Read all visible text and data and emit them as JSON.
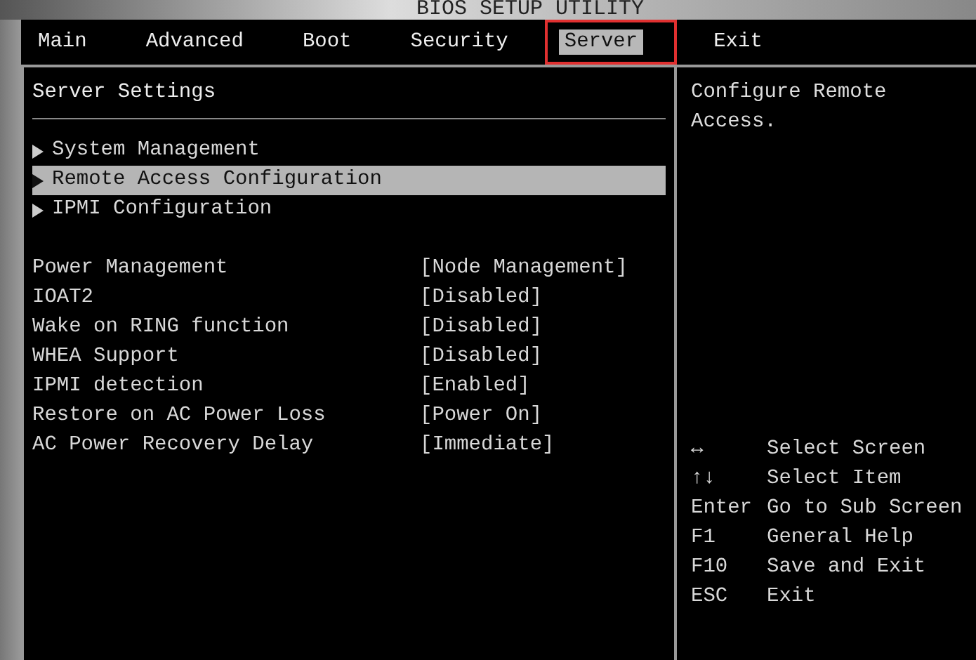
{
  "window": {
    "title": "BIOS SETUP UTILITY"
  },
  "tabs": [
    {
      "label": "Main",
      "selected": false,
      "annotated": false
    },
    {
      "label": "Advanced",
      "selected": false,
      "annotated": false
    },
    {
      "label": "Boot",
      "selected": false,
      "annotated": false
    },
    {
      "label": "Security",
      "selected": false,
      "annotated": false
    },
    {
      "label": "Server",
      "selected": true,
      "annotated": true
    },
    {
      "label": "Exit",
      "selected": false,
      "annotated": false
    }
  ],
  "panel": {
    "title": "Server Settings",
    "submenus": [
      {
        "label": "System Management",
        "selected": false
      },
      {
        "label": "Remote Access Configuration",
        "selected": true
      },
      {
        "label": "IPMI Configuration",
        "selected": false
      }
    ],
    "settings": [
      {
        "name": "Power Management",
        "value": "[Node Management]"
      },
      {
        "name": "IOAT2",
        "value": "[Disabled]"
      },
      {
        "name": "Wake on RING function",
        "value": "[Disabled]"
      },
      {
        "name": "WHEA Support",
        "value": "[Disabled]"
      },
      {
        "name": "IPMI detection",
        "value": "[Enabled]"
      },
      {
        "name": "Restore on AC Power Loss",
        "value": "[Power On]"
      },
      {
        "name": "AC Power Recovery Delay",
        "value": "[Immediate]"
      }
    ]
  },
  "help": {
    "text": "Configure Remote Access.",
    "keys": [
      {
        "key": "↔",
        "action": "Select Screen"
      },
      {
        "key": "↑↓",
        "action": "Select Item"
      },
      {
        "key": "Enter",
        "action": "Go to Sub Screen"
      },
      {
        "key": "F1",
        "action": "General Help"
      },
      {
        "key": "F10",
        "action": "Save and Exit"
      },
      {
        "key": "ESC",
        "action": "Exit"
      }
    ]
  }
}
